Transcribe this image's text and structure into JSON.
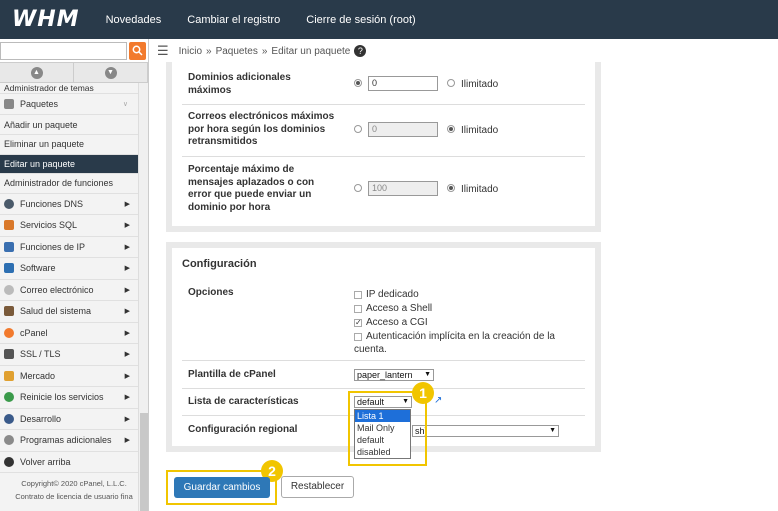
{
  "topbar": {
    "logo": "WHM",
    "nav": [
      "Novedades",
      "Cambiar el registro",
      "Cierre de sesión (root)"
    ]
  },
  "breadcrumb": {
    "items": [
      "Inicio",
      "Paquetes",
      "Editar un paquete"
    ],
    "sep": "»",
    "help": "?"
  },
  "sidebar": {
    "items": [
      {
        "label": "Administrador de temas",
        "active": false
      },
      {
        "label": "Paquetes",
        "active": false
      },
      {
        "label": "Añadir un paquete",
        "active": false
      },
      {
        "label": "Eliminar un paquete",
        "active": false
      },
      {
        "label": "Editar un paquete",
        "active": true
      },
      {
        "label": "Administrador de funciones",
        "active": false
      },
      {
        "label": "Funciones DNS",
        "active": false
      },
      {
        "label": "Servicios SQL",
        "active": false
      },
      {
        "label": "Funciones de IP",
        "active": false
      },
      {
        "label": "Software",
        "active": false
      },
      {
        "label": "Correo electrónico",
        "active": false
      },
      {
        "label": "Salud del sistema",
        "active": false
      },
      {
        "label": "cPanel",
        "active": false
      },
      {
        "label": "SSL / TLS",
        "active": false
      },
      {
        "label": "Mercado",
        "active": false
      },
      {
        "label": "Reinicie los servicios",
        "active": false
      },
      {
        "label": "Desarrollo",
        "active": false
      },
      {
        "label": "Programas adicionales",
        "active": false
      },
      {
        "label": "Volver arriba",
        "active": false
      }
    ],
    "copyright": "Copyright© 2020 cPanel, L.L.C.",
    "license": "Contrato de licencia de usuario fina"
  },
  "limits": {
    "addon_domains_label_1": "Dominios adicionales",
    "addon_domains_label_2": "máximos",
    "addon_domains_value": "0",
    "unlimited": "Ilimitado",
    "emails_label_1": "Correos electrónicos máximos",
    "emails_label_2": "por hora según los dominios",
    "emails_label_3": "retransmitidos",
    "emails_value": "0",
    "deferred_label_1": "Porcentaje máximo de",
    "deferred_label_2": "mensajes aplazados o con",
    "deferred_label_3": "error que puede enviar un",
    "deferred_label_4": "dominio por hora",
    "deferred_value": "100"
  },
  "config": {
    "title": "Configuración",
    "options_label": "Opciones",
    "opt_ip": "IP dedicado",
    "opt_shell": "Acceso a Shell",
    "opt_cgi": "Acceso a CGI",
    "opt_auth_1": "Autenticación implícita en la creación de la",
    "opt_auth_2": "cuenta.",
    "template_label": "Plantilla de cPanel",
    "template_value": "paper_lantern",
    "features_label": "Lista de características",
    "features_value": "default",
    "features_options": [
      "Lista 1",
      "Mail Only",
      "default",
      "disabled"
    ],
    "locale_label": "Configuración regional",
    "locale_value_tail": "sh)"
  },
  "buttons": {
    "save": "Guardar cambios",
    "reset": "Restablecer"
  },
  "badges": {
    "one": "1",
    "two": "2"
  },
  "colors": {
    "topbar": "#293a4a",
    "accent": "#f1c500",
    "primary": "#2e78b7",
    "search": "#f27a2d"
  }
}
